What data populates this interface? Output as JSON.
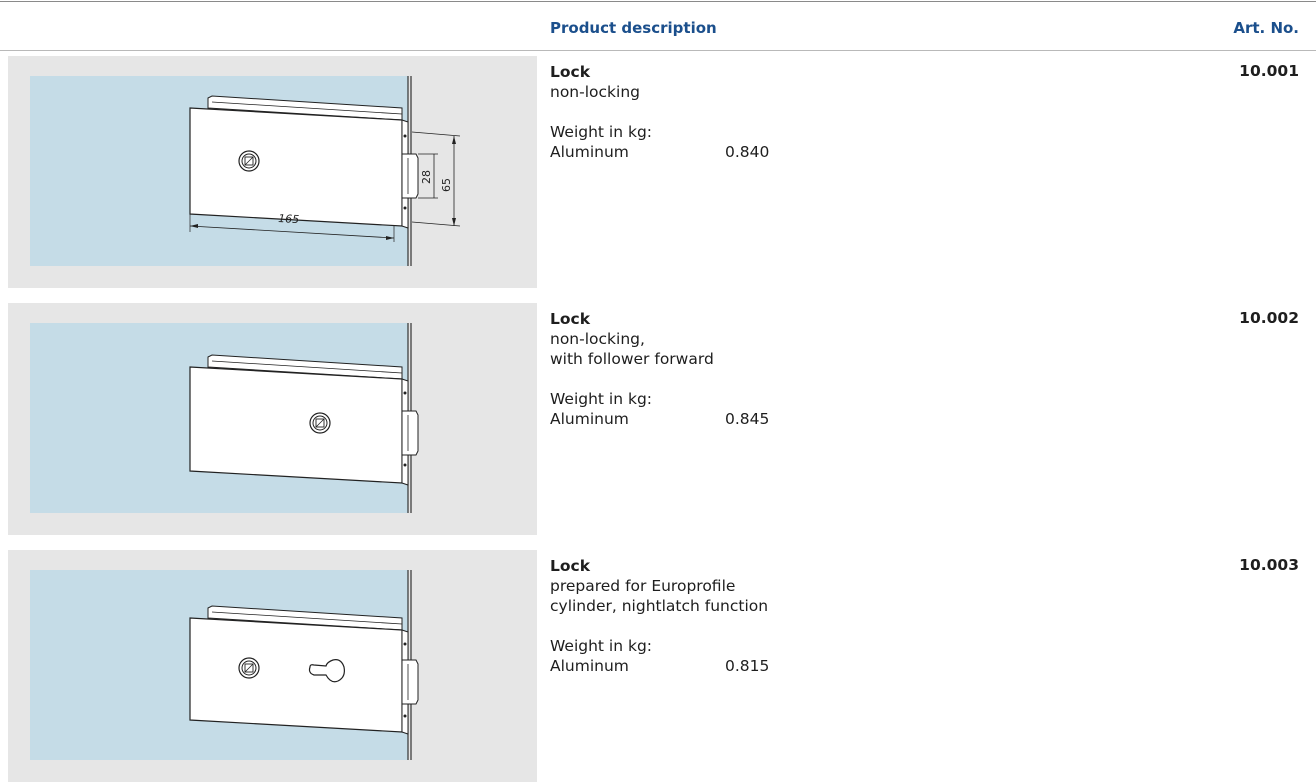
{
  "header": {
    "description_label": "Product description",
    "art_no_label": "Art. No."
  },
  "items": [
    {
      "title": "Lock",
      "lines": [
        "non-locking"
      ],
      "weight_label": "Weight in kg:",
      "material": "Aluminum",
      "weight": "0.840",
      "art_no": "10.001",
      "dims": {
        "length": "165",
        "height_inner": "28",
        "height_outer": "65"
      },
      "icons": [
        "lock-drawing-icon",
        "follower-knob-icon"
      ]
    },
    {
      "title": "Lock",
      "lines": [
        "non-locking,",
        "with follower forward"
      ],
      "weight_label": "Weight in kg:",
      "material": "Aluminum",
      "weight": "0.845",
      "art_no": "10.002",
      "icons": [
        "lock-drawing-icon",
        "follower-knob-icon"
      ]
    },
    {
      "title": "Lock",
      "lines": [
        "prepared for Europrofile",
        "cylinder, nightlatch function"
      ],
      "weight_label": "Weight in kg:",
      "material": "Aluminum",
      "weight": "0.815",
      "art_no": "10.003",
      "icons": [
        "lock-drawing-icon",
        "follower-knob-icon",
        "europrofile-keyhole-icon"
      ]
    }
  ],
  "colors": {
    "header_blue": "#1b4f8c",
    "glass": "#c5dce7",
    "panel_bg": "#e6e6e6"
  }
}
